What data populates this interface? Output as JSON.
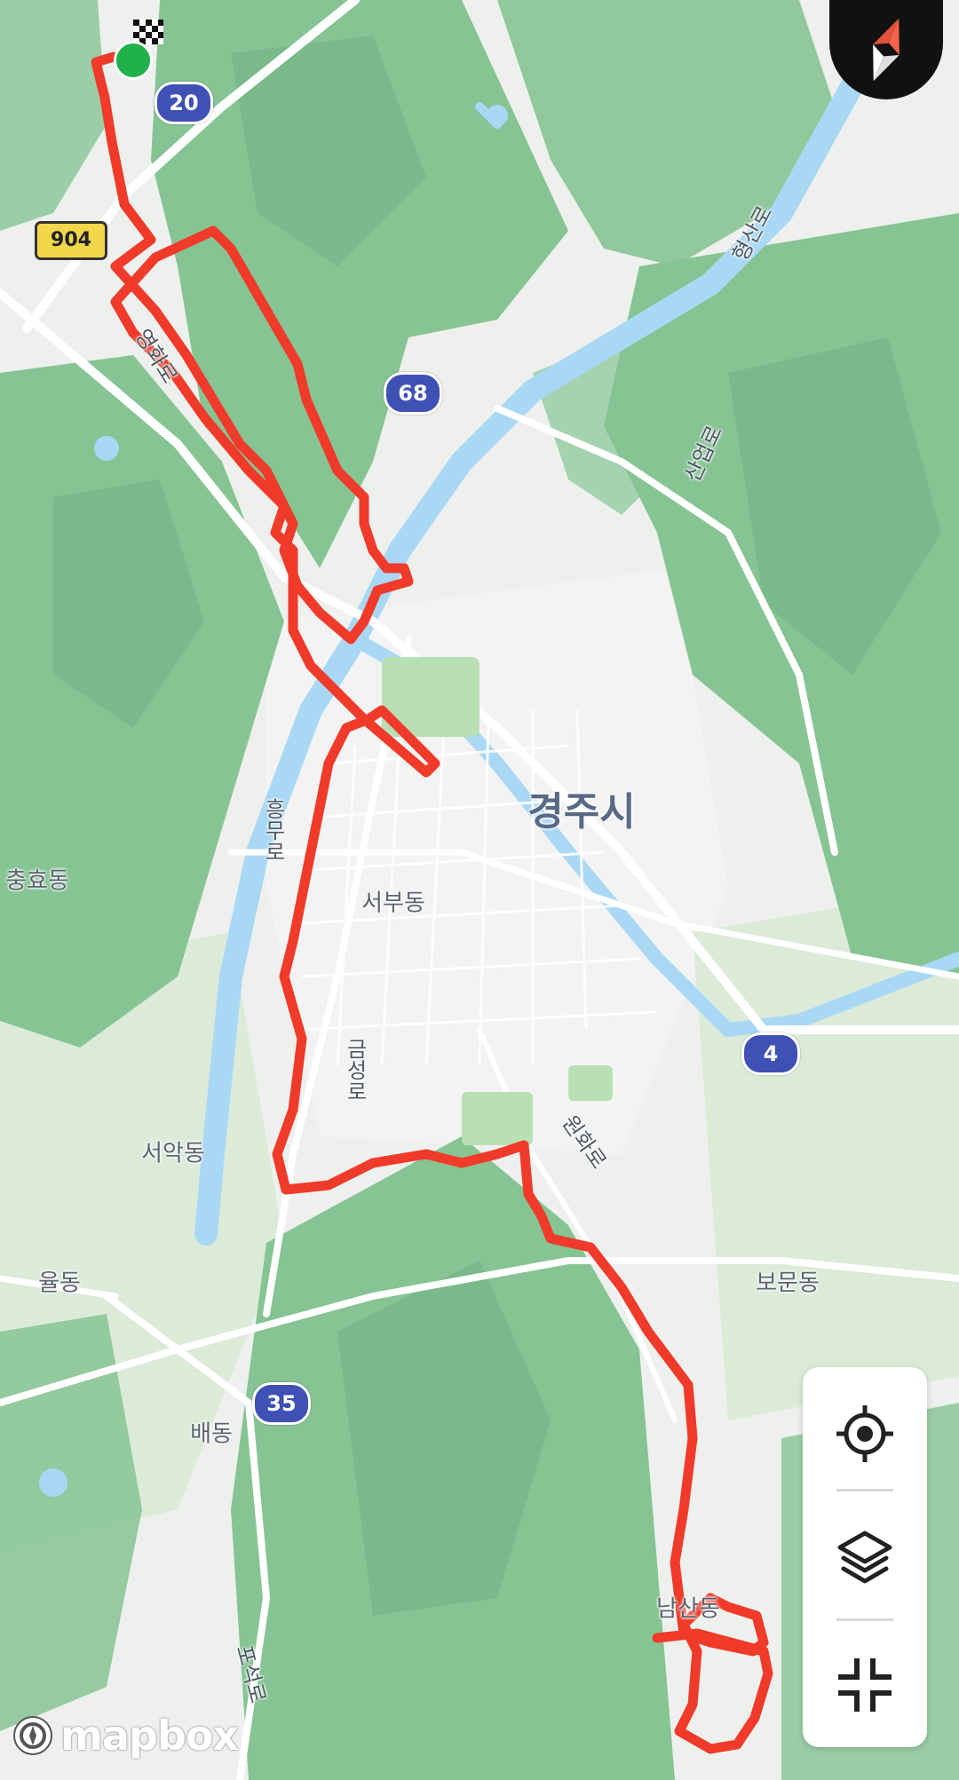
{
  "map": {
    "city_label": "경주시",
    "districts": [
      {
        "id": "chunghyo",
        "text": "충효동"
      },
      {
        "id": "seobu",
        "text": "서부동"
      },
      {
        "id": "seoak",
        "text": "서악동"
      },
      {
        "id": "yul",
        "text": "율동"
      },
      {
        "id": "bomun",
        "text": "보문동"
      },
      {
        "id": "bae",
        "text": "배동"
      },
      {
        "id": "namsan",
        "text": "남산동"
      }
    ],
    "roads": [
      {
        "id": "heungmu",
        "text": "흥무로"
      },
      {
        "id": "geumseong",
        "text": "금성로"
      },
      {
        "id": "wonhwa",
        "text": "원화로"
      },
      {
        "id": "poseok",
        "text": "포석로"
      },
      {
        "id": "sanup",
        "text": "산업로"
      },
      {
        "id": "hyeongsan",
        "text": "형산로"
      },
      {
        "id": "yeonghwa",
        "text": "영화로"
      }
    ],
    "shields_national": [
      "20",
      "68",
      "4",
      "35"
    ],
    "shield_local": "904",
    "route_color": "#f03a2a",
    "start_color": "#21b14a",
    "water_color": "#a9d8f5",
    "forest_color": "#86c494"
  },
  "controls": {
    "locate_icon": "crosshair-icon",
    "layers_icon": "layers-icon",
    "collapse_icon": "collapse-icon"
  },
  "compass": {
    "icon": "compass-needle-icon"
  },
  "attribution": {
    "brand": "mapbox"
  }
}
